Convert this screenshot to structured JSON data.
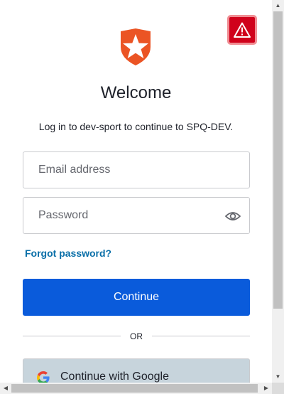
{
  "brand": {
    "logo_icon": "auth0-shield-star-logo",
    "logo_color": "#eb5424"
  },
  "alert": {
    "icon": "warning-triangle-icon",
    "color": "#d0011b"
  },
  "header": {
    "title": "Welcome",
    "subtitle": "Log in to dev-sport to continue to SPQ-DEV."
  },
  "form": {
    "email": {
      "placeholder": "Email address",
      "value": ""
    },
    "password": {
      "placeholder": "Password",
      "value": "",
      "toggle_icon": "eye-icon"
    },
    "forgot_password": "Forgot password?",
    "continue_label": "Continue",
    "divider": "OR"
  },
  "social": {
    "google_label": "Continue with Google",
    "google_icon": "google-g-icon"
  },
  "colors": {
    "primary": "#0a5bdb",
    "link": "#0a6fa8",
    "google_button_bg": "#c7d4dc"
  },
  "scrollbars": {
    "up_arrow": "▲",
    "down_arrow": "▼",
    "left_arrow": "◀",
    "right_arrow": "▶"
  }
}
